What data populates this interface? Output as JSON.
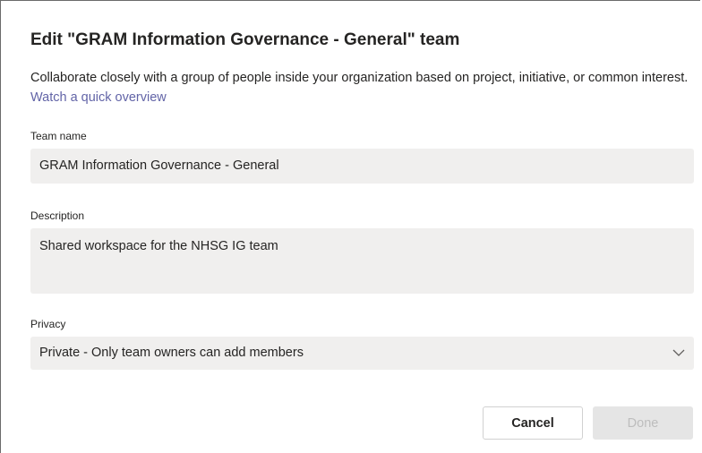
{
  "dialog": {
    "title": "Edit \"GRAM Information Governance - General\" team",
    "intro_text": "Collaborate closely with a group of people inside your organization based on project, initiative, or common interest. ",
    "intro_link": "Watch a quick overview"
  },
  "team_name": {
    "label": "Team name",
    "value": "GRAM Information Governance - General"
  },
  "description": {
    "label": "Description",
    "value": "Shared workspace for the NHSG IG team"
  },
  "privacy": {
    "label": "Privacy",
    "selected": "Private - Only team owners can add members"
  },
  "buttons": {
    "cancel": "Cancel",
    "done": "Done"
  },
  "colors": {
    "accent": "#6264a7",
    "field_bg": "#f0efee",
    "disabled_bg": "#e5e5e5"
  },
  "icons": {
    "privacy_dropdown": "chevron-down-icon"
  }
}
